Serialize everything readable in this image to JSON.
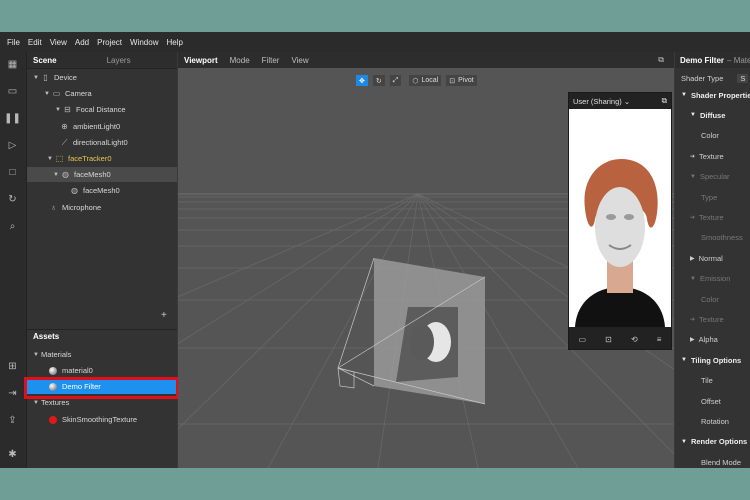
{
  "menu": [
    "File",
    "Edit",
    "View",
    "Add",
    "Project",
    "Window",
    "Help"
  ],
  "scene": {
    "tabs": [
      "Scene",
      "Layers"
    ],
    "tree": [
      {
        "label": "Device",
        "icon": "phone-icon"
      },
      {
        "label": "Camera",
        "icon": "camera-icon"
      },
      {
        "label": "Focal Distance",
        "icon": "focal-distance-icon"
      },
      {
        "label": "ambientLight0",
        "icon": "globe-light-icon"
      },
      {
        "label": "directionalLight0",
        "icon": "sun-light-icon"
      },
      {
        "label": "faceTracker0",
        "icon": "face-tracker-icon"
      },
      {
        "label": "faceMesh0",
        "icon": "mesh-icon"
      },
      {
        "label": "faceMesh0",
        "icon": "mesh-icon"
      },
      {
        "label": "Microphone",
        "icon": "microphone-icon"
      }
    ],
    "add_symbol": "+"
  },
  "assets": {
    "title": "Assets",
    "materials_label": "Materials",
    "materials": [
      "material0",
      "Demo Filter"
    ],
    "textures_label": "Textures",
    "textures": [
      "SkinSmoothingTexture"
    ]
  },
  "viewport": {
    "tabs": [
      "Viewport",
      "Mode",
      "Filter",
      "View"
    ],
    "toolbar": {
      "local": "Local",
      "pivot": "Pivot"
    }
  },
  "preview": {
    "title": "User (Sharing)"
  },
  "properties": {
    "title": "Demo Filter",
    "subtitle": "– Materi",
    "shader_type_label": "Shader Type",
    "shader_type_value": "S",
    "rows": [
      {
        "label": "Shader Propertie",
        "kind": "section"
      },
      {
        "label": "Diffuse",
        "kind": "subsection"
      },
      {
        "label": "Color",
        "kind": "item"
      },
      {
        "label": "Texture",
        "kind": "item-arrow"
      },
      {
        "label": "Specular",
        "kind": "subsection-dim"
      },
      {
        "label": "Type",
        "kind": "dim"
      },
      {
        "label": "Texture",
        "kind": "dim-arrow"
      },
      {
        "label": "Smoothness",
        "kind": "dim"
      },
      {
        "label": "Normal",
        "kind": "subsection-collapsed"
      },
      {
        "label": "Emission",
        "kind": "subsection-dim"
      },
      {
        "label": "Color",
        "kind": "dim"
      },
      {
        "label": "Texture",
        "kind": "dim-arrow"
      },
      {
        "label": "Alpha",
        "kind": "subsection-collapsed"
      },
      {
        "label": "Tiling Options",
        "kind": "section"
      },
      {
        "label": "Tile",
        "kind": "item"
      },
      {
        "label": "Offset",
        "kind": "item"
      },
      {
        "label": "Rotation",
        "kind": "item"
      },
      {
        "label": "Render Options",
        "kind": "section"
      },
      {
        "label": "Blend Mode",
        "kind": "item"
      }
    ]
  },
  "colors": {
    "selection": "#1e90f0",
    "highlight_box": "#e0101a",
    "background": "#6f9e97"
  }
}
